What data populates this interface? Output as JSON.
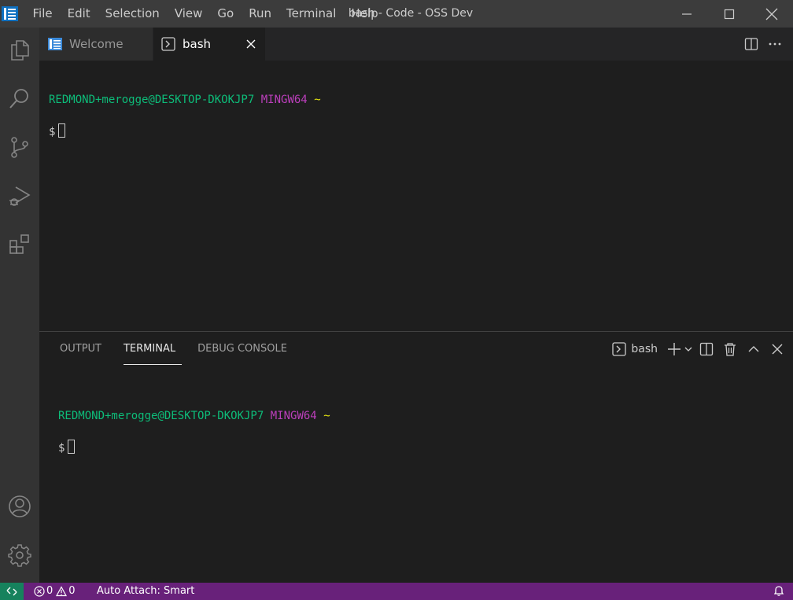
{
  "window": {
    "title": "bash - Code - OSS Dev"
  },
  "menu": {
    "items": [
      "File",
      "Edit",
      "Selection",
      "View",
      "Go",
      "Run",
      "Terminal",
      "Help"
    ]
  },
  "tabs": {
    "welcome_label": "Welcome",
    "bash_label": "bash"
  },
  "editor_terminal": {
    "user_host": "REDMOND+merogge@DESKTOP-DKOKJP7",
    "env": "MINGW64",
    "path": "~",
    "prompt": "$"
  },
  "panel": {
    "tabs": [
      "OUTPUT",
      "TERMINAL",
      "DEBUG CONSOLE"
    ],
    "active_tab": "TERMINAL",
    "terminal_name": "bash"
  },
  "panel_terminal": {
    "user_host": "REDMOND+merogge@DESKTOP-DKOKJP7",
    "env": "MINGW64",
    "path": "~",
    "prompt": "$"
  },
  "statusbar": {
    "errors": "0",
    "warnings": "0",
    "auto_attach": "Auto Attach: Smart"
  },
  "colors": {
    "statusbar": "#68217a",
    "remote": "#16825d",
    "prompt_green": "#0dbc79",
    "prompt_magenta": "#bc3fbc",
    "prompt_yellow": "#e5e510"
  }
}
